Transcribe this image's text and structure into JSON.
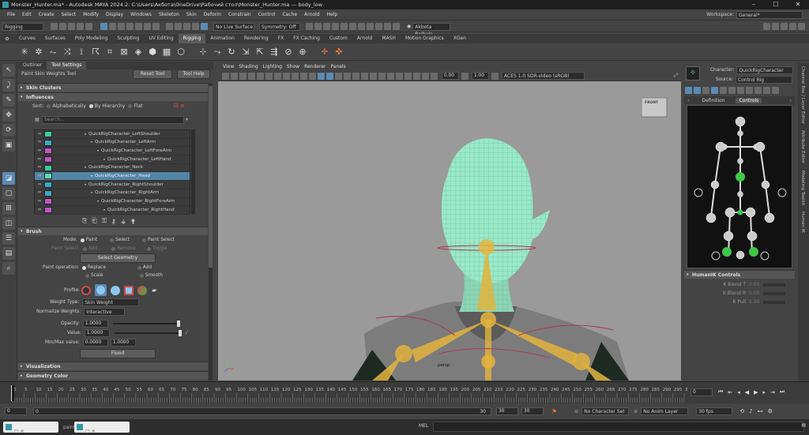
{
  "window": {
    "title": "Monster_Hunter.ma* - Autodesk MAYA 2024.2: C:\\Users\\Акбота\\OneDrive\\Рабочий стол\\Monster_Hunter.ma  ---  body_low"
  },
  "menubar": [
    "File",
    "Edit",
    "Create",
    "Select",
    "Modify",
    "Display",
    "Windows",
    "Skeleton",
    "Skin",
    "Deform",
    "Constrain",
    "Control",
    "Cache",
    "Arnold",
    "Help"
  ],
  "workspace": {
    "label": "Workspace:",
    "value": "General*"
  },
  "statusline": {
    "mode": "Rigging",
    "live_surface": "No Live Surface",
    "symmetry": "Symmetry: Off",
    "user": "Akbota Baibulo..."
  },
  "shelf_tabs": [
    "Curves",
    "Surfaces",
    "Poly Modeling",
    "Sculpting",
    "UV Editing",
    "Rigging",
    "Animation",
    "Rendering",
    "FX",
    "FX Caching",
    "Custom",
    "Arnold",
    "MASH",
    "Motion Graphics",
    "XGen"
  ],
  "active_shelf": "Rigging",
  "left_panel": {
    "tabs": [
      "Outliner",
      "Tool Settings"
    ],
    "tool_name": "Paint Skin Weights Tool",
    "reset_label": "Reset Tool",
    "help_label": "Tool Help",
    "skin_clusters": "Skin Clusters",
    "influences": "Influences",
    "sort_label": "Sort:",
    "sort_opts": [
      "Alphabetically",
      "By Hierarchy",
      "Flat"
    ],
    "search_placeholder": "Search...",
    "joints": [
      {
        "name": "QuickRigCharacter_LeftShoulder",
        "color": "#3ec9a5",
        "selected": false
      },
      {
        "name": "QuickRigCharacter_LeftArm",
        "color": "#3da7c8",
        "selected": false
      },
      {
        "name": "QuickRigCharacter_LeftForeArm",
        "color": "#c156c4",
        "selected": false
      },
      {
        "name": "QuickRigCharacter_LeftHand",
        "color": "#c156c4",
        "selected": false
      },
      {
        "name": "QuickRigCharacter_Neck",
        "color": "#3ec9a5",
        "selected": false
      },
      {
        "name": "QuickRigCharacter_Head",
        "color": "#5fdcb3",
        "selected": true
      },
      {
        "name": "QuickRigCharacter_RightShoulder",
        "color": "#3da7c8",
        "selected": false
      },
      {
        "name": "QuickRigCharacter_RightArm",
        "color": "#3da7c8",
        "selected": false
      },
      {
        "name": "QuickRigCharacter_RightForeArm",
        "color": "#c156c4",
        "selected": false
      },
      {
        "name": "QuickRigCharacter_RightHand",
        "color": "#c156c4",
        "selected": false
      }
    ],
    "brush": "Brush",
    "mode_label": "Mode:",
    "mode_opts": [
      "Paint",
      "Select",
      "Paint Select"
    ],
    "paint_select_label": "Paint Select:",
    "paint_select_opts": [
      "Add",
      "Remove",
      "Toggle"
    ],
    "select_geometry": "Select Geometry",
    "paint_op_label": "Paint operation:",
    "paint_ops": [
      "Replace",
      "Add",
      "Scale",
      "Smooth"
    ],
    "profile_label": "Profile:",
    "weight_type_label": "Weight Type:",
    "weight_type": "Skin Weight",
    "normalize_label": "Normalize Weights:",
    "normalize": "Interactive",
    "opacity_label": "Opacity:",
    "opacity": "1.0000",
    "value_label": "Value:",
    "value": "1.0000",
    "minmax_label": "Min/Max value:",
    "min": "0.0000",
    "max": "1.0000",
    "flood": "Flood",
    "visualization": "Visualization",
    "geometry_color": "Geometry Color"
  },
  "viewport": {
    "menus": [
      "View",
      "Shading",
      "Lighting",
      "Show",
      "Renderer",
      "Panels"
    ],
    "num1": "0.00",
    "num2": "1.00",
    "color_space": "ACES 1.0 SDR-video (sRGB)",
    "camera": "persp",
    "cube": "FRONT"
  },
  "hik": {
    "character_label": "Character:",
    "character": "QuickRigCharacter",
    "source_label": "Source:",
    "source": "Control Rig",
    "tabs": [
      "Definition",
      "Controls"
    ],
    "active_tab": "Controls",
    "controls_section": "HumanIK Controls",
    "sliders": [
      {
        "label": "K Blend T",
        "value": "0.00"
      },
      {
        "label": "K Blend R",
        "value": "0.00"
      },
      {
        "label": "K Pull",
        "value": "0.00"
      }
    ]
  },
  "side_strip": [
    "Channel Box / Layer Editor",
    "Attribute Editor",
    "Modeling Toolkit",
    "Human IK"
  ],
  "timeline": {
    "ticks": [
      "0",
      "5",
      "10",
      "15",
      "20",
      "25",
      "30",
      "35",
      "40",
      "45",
      "50",
      "55",
      "60",
      "65",
      "70",
      "75",
      "80",
      "85",
      "90",
      "95",
      "100",
      "105",
      "110",
      "115",
      "120",
      "125",
      "130",
      "135",
      "140",
      "145",
      "150",
      "155",
      "160",
      "165",
      "170",
      "175",
      "180",
      "185",
      "190",
      "195",
      "200",
      "205",
      "210",
      "215",
      "220",
      "225",
      "230",
      "235",
      "240",
      "245",
      "250",
      "255",
      "260",
      "265",
      "270",
      "275",
      "280",
      "285",
      "290",
      "295",
      "300"
    ],
    "current_frame": "0"
  },
  "range": {
    "start": "0",
    "inner_start": "0",
    "inner_end": "30",
    "end": "30",
    "end2": "30",
    "character_set": "No Character Set",
    "anim_layer": "No Anim Layer",
    "fps": "30 fps"
  },
  "cmdline": {
    "mel_label": "MEL",
    "help_hint": "painting"
  }
}
